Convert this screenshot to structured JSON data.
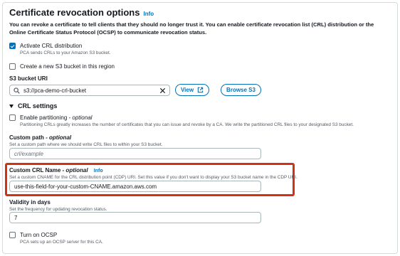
{
  "header": {
    "title": "Certificate revocation options",
    "info": "Info",
    "description": "You can revoke a certificate to tell clients that they should no longer trust it. You can enable certificate revocation list (CRL) distribution or the Online Certificate Status Protocol (OCSP) to communicate revocation status."
  },
  "crl_distribution": {
    "label": "Activate CRL distribution",
    "sub": "PCA sends CRLs to your Amazon S3 bucket.",
    "checked": true
  },
  "new_bucket": {
    "label": "Create a new S3 bucket in this region",
    "checked": false
  },
  "s3_uri": {
    "label": "S3 bucket URI",
    "value": "s3://pca-demo-crl-bucket",
    "view_label": "View",
    "browse_label": "Browse S3"
  },
  "crl_settings": {
    "title": "CRL settings"
  },
  "partitioning": {
    "label": "Enable partitioning",
    "optional": "- optional",
    "sub": "Partitioning CRLs greatly increases the number of certificates that you can issue and revoke by a CA. We write the partitioned CRL files to your designated S3 bucket.",
    "checked": false
  },
  "custom_path": {
    "label": "Custom path",
    "optional": "- optional",
    "desc": "Set a custom path where we should write CRL files to within your S3 bucket.",
    "placeholder": "crl/example"
  },
  "custom_crl_name": {
    "label": "Custom CRL Name",
    "optional": "- optional",
    "info": "Info",
    "desc": "Set a custom CNAME for the CRL distribution point (CDP) URI. Set this value if you don't want to display your S3 bucket name in the CDP URI.",
    "value": "use-this-field-for-your-custom-CNAME.amazon.aws.com"
  },
  "validity": {
    "label": "Validity in days",
    "desc": "Set the frequency for updating revocation status.",
    "value": "7"
  },
  "ocsp": {
    "label": "Turn on OCSP",
    "sub": "PCA sets up an OCSP server for this CA.",
    "checked": false
  },
  "colors": {
    "link": "#0073bb",
    "highlight": "#d13212"
  }
}
